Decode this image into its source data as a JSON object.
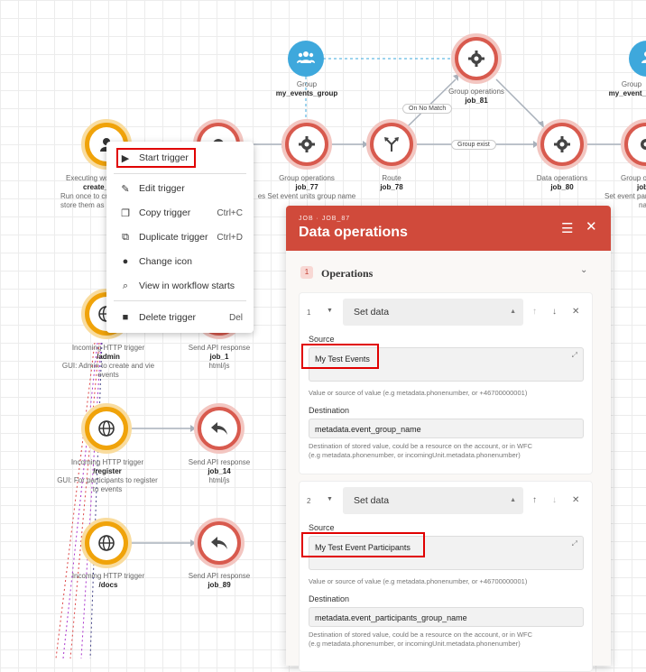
{
  "nodes": {
    "group1": {
      "title": "Group",
      "name": "my_events_group"
    },
    "group2": {
      "title": "Group",
      "name": "my_event_pa"
    },
    "trigger_main": {
      "title": "Executing wo",
      "name": "create_",
      "desc1": "Run once to cre",
      "desc2": "store them as"
    },
    "job77": {
      "title": "Group operations",
      "name": "job_77",
      "desc": "es Set event units group name"
    },
    "job78": {
      "title": "Route",
      "name": "job_78"
    },
    "job81": {
      "title": "Group operations",
      "name": "job_81"
    },
    "job80": {
      "title": "Data operations",
      "name": "job_80"
    },
    "groupop_right": {
      "title": "Group o",
      "name": "job",
      "desc1": "Set event par",
      "desc2": "na"
    },
    "admin": {
      "title": "Incoming HTTP trigger",
      "name": "/admin",
      "desc1": "GUI: Admin to create and vie",
      "desc2": "events"
    },
    "job1": {
      "title": "Send API response",
      "name": "job_1",
      "desc": "html/js"
    },
    "register": {
      "title": "Incoming HTTP trigger",
      "name": "/register",
      "desc1": "GUI: For participants to register",
      "desc2": "to events"
    },
    "job14": {
      "title": "Send API response",
      "name": "job_14",
      "desc": "html/js"
    },
    "docs": {
      "title": "Incoming HTTP trigger",
      "name": "/docs"
    },
    "job89": {
      "title": "Send API response",
      "name": "job_89"
    }
  },
  "edges": {
    "on_no_match": "On No Match",
    "group_exist": "Group exist"
  },
  "context_menu": {
    "items": [
      {
        "label": "Start trigger",
        "icon": "play-icon",
        "shortcut": ""
      },
      {
        "label": "Edit trigger",
        "icon": "pencil-icon",
        "shortcut": ""
      },
      {
        "label": "Copy trigger",
        "icon": "copy-icon",
        "shortcut": "Ctrl+C"
      },
      {
        "label": "Duplicate trigger",
        "icon": "duplicate-icon",
        "shortcut": "Ctrl+D"
      },
      {
        "label": "Change icon",
        "icon": "palette-icon",
        "shortcut": ""
      },
      {
        "label": "View in workflow starts",
        "icon": "search-icon",
        "shortcut": ""
      },
      {
        "label": "Delete trigger",
        "icon": "trash-icon",
        "shortcut": "Del"
      }
    ]
  },
  "panel": {
    "subtitle": "JOB · JOB_87",
    "title": "Data operations",
    "section_number": "1",
    "section_title": "Operations",
    "operations": [
      {
        "index": "1",
        "type": "Set data",
        "source_label": "Source",
        "source_value": "My Test Events",
        "source_help": "Value or source of value (e.g metadata.phonenumber, or +46700000001)",
        "dest_label": "Destination",
        "dest_value": "metadata.event_group_name",
        "dest_help1": "Destination of stored value, could be a resource on the account, or in WFC",
        "dest_help2": "(e.g metadata.phonenumber, or incomingUnit.metadata.phonenumber)"
      },
      {
        "index": "2",
        "type": "Set data",
        "source_label": "Source",
        "source_value": "My Test Event Participants",
        "source_help": "Value or source of value (e.g metadata.phonenumber, or +46700000001)",
        "dest_label": "Destination",
        "dest_value": "metadata.event_participants_group_name",
        "dest_help1": "Destination of stored value, could be a resource on the account, or in WFC",
        "dest_help2": "(e.g metadata.phonenumber, or incomingUnit.metadata.phonenumber)"
      }
    ]
  },
  "colors": {
    "node_red": "#d85a4e",
    "node_yellow": "#f0a30a",
    "node_blue": "#3ea8dc",
    "header_red": "#d04a3b",
    "highlight": "#e00000"
  }
}
